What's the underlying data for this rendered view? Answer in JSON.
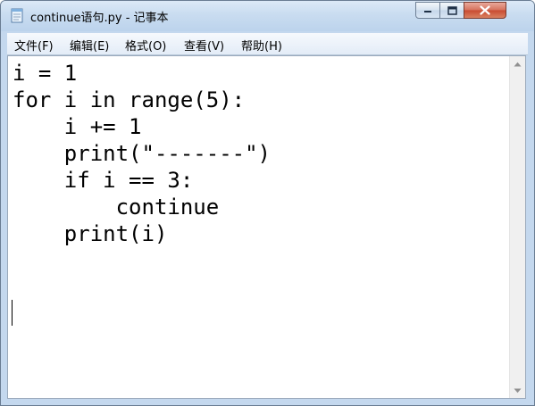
{
  "window": {
    "title": "continue语句.py - 记事本"
  },
  "menu": {
    "items": [
      {
        "label": "文件(F)"
      },
      {
        "label": "编辑(E)"
      },
      {
        "label": "格式(O)"
      },
      {
        "label": "查看(V)"
      },
      {
        "label": "帮助(H)"
      }
    ]
  },
  "editor": {
    "lines": [
      "i = 1",
      "for i in range(5):",
      "    i += 1",
      "    print(\"-------\")",
      "    if i == 3:",
      "        continue",
      "    print(i)"
    ]
  }
}
